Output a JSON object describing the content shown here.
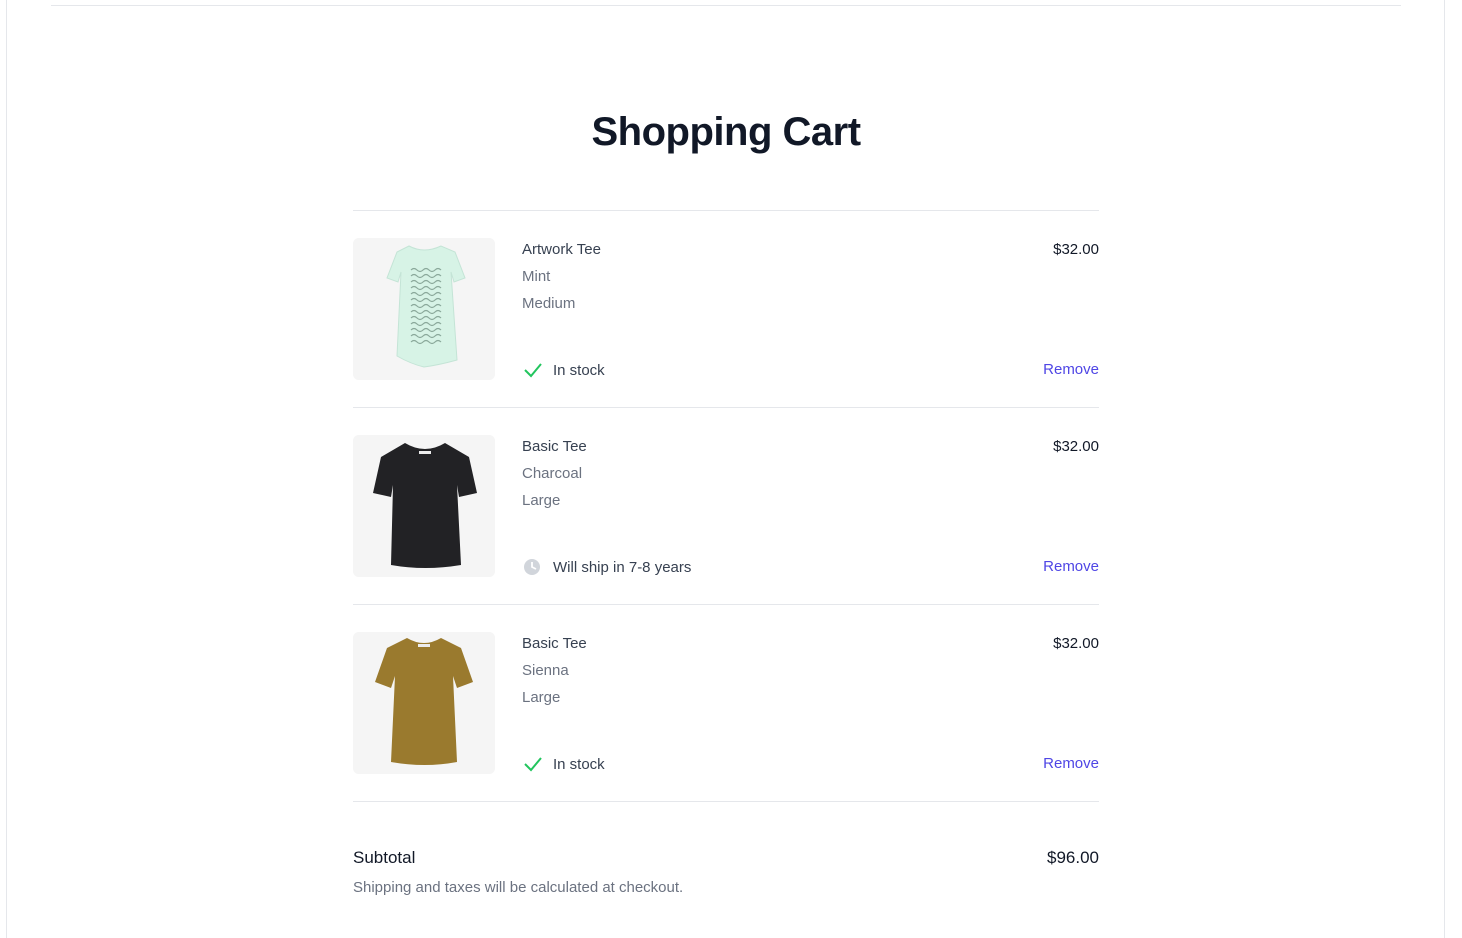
{
  "page": {
    "title": "Shopping Cart"
  },
  "cart": {
    "items": [
      {
        "name": "Artwork Tee",
        "color": "Mint",
        "size": "Medium",
        "price": "$32.00",
        "status_icon": "check-icon",
        "status": "In stock",
        "remove_label": "Remove",
        "shirt_color": "#d7f3e6"
      },
      {
        "name": "Basic Tee",
        "color": "Charcoal",
        "size": "Large",
        "price": "$32.00",
        "status_icon": "clock-icon",
        "status": "Will ship in 7-8 years",
        "remove_label": "Remove",
        "shirt_color": "#222225"
      },
      {
        "name": "Basic Tee",
        "color": "Sienna",
        "size": "Large",
        "price": "$32.00",
        "status_icon": "check-icon",
        "status": "In stock",
        "remove_label": "Remove",
        "shirt_color": "#9a7a2e"
      }
    ]
  },
  "summary": {
    "subtotal_label": "Subtotal",
    "subtotal_value": "$96.00",
    "note": "Shipping and taxes will be calculated at checkout."
  },
  "colors": {
    "accent": "#4f46e5",
    "in_stock": "#22c55e",
    "clock": "#d1d5db"
  }
}
